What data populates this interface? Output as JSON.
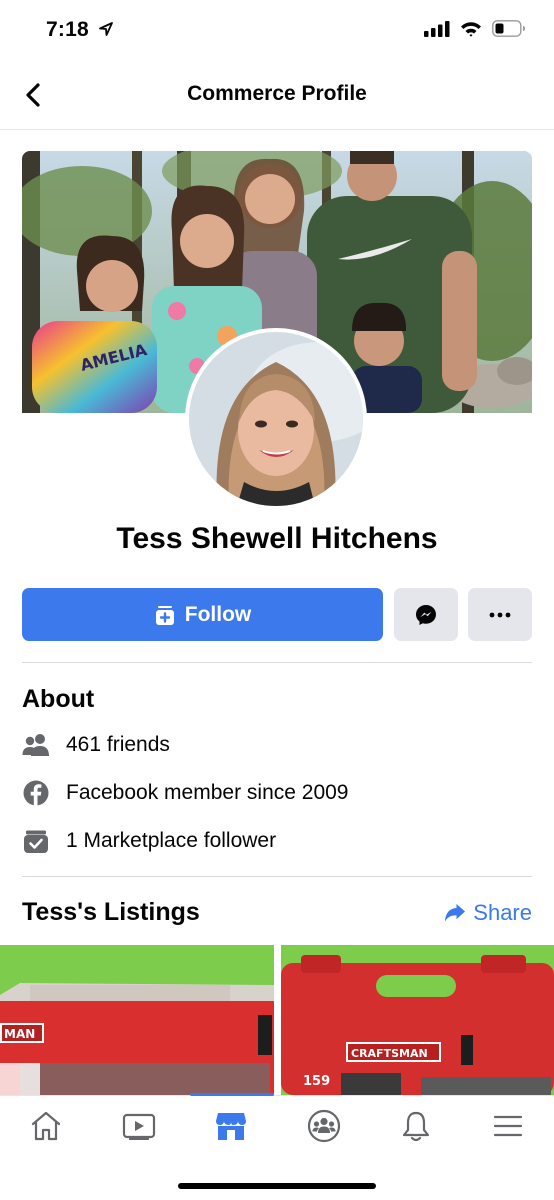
{
  "status_bar": {
    "time": "7:18"
  },
  "header": {
    "title": "Commerce Profile"
  },
  "profile": {
    "name": "Tess Shewell Hitchens"
  },
  "actions": {
    "follow_label": "Follow"
  },
  "about": {
    "title": "About",
    "items": [
      {
        "icon": "friends-icon",
        "text": "461 friends"
      },
      {
        "icon": "facebook-icon",
        "text": "Facebook member since 2009"
      },
      {
        "icon": "marketplace-follower-icon",
        "text": "1 Marketplace follower"
      }
    ]
  },
  "listings": {
    "title": "Tess's Listings",
    "share_label": "Share",
    "items": [
      {
        "brand": "MAN",
        "box_text": ""
      },
      {
        "brand": "CRAFTSMAN",
        "count": "159"
      }
    ]
  },
  "tabbar": {
    "tabs": [
      "home-icon",
      "video-icon",
      "marketplace-icon",
      "groups-icon",
      "notifications-icon",
      "menu-icon"
    ],
    "active": "marketplace-icon"
  },
  "colors": {
    "accent": "#3b79ec",
    "button_gray": "#e4e6eb"
  }
}
